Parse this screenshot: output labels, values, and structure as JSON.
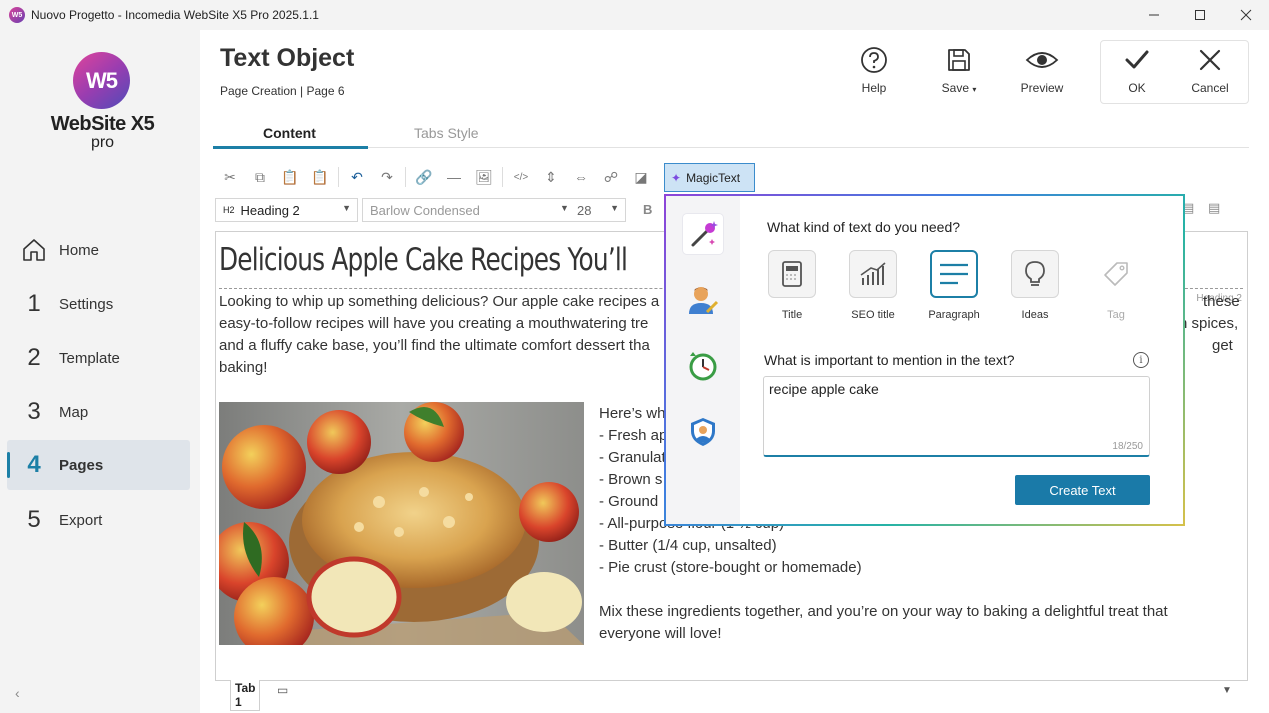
{
  "window": {
    "title": "Nuovo Progetto - Incomedia WebSite X5 Pro 2025.1.1",
    "app_icon_text": "W5"
  },
  "logo": {
    "mark": "W5",
    "name": "WebSite X5",
    "edition": "pro"
  },
  "sidebar": {
    "items": [
      {
        "num": "",
        "label": "Home"
      },
      {
        "num": "1",
        "label": "Settings"
      },
      {
        "num": "2",
        "label": "Template"
      },
      {
        "num": "3",
        "label": "Map"
      },
      {
        "num": "4",
        "label": "Pages"
      },
      {
        "num": "5",
        "label": "Export"
      }
    ],
    "active": "Pages"
  },
  "header": {
    "title": "Text Object",
    "breadcrumb": "Page Creation | Page 6",
    "buttons": {
      "help": "Help",
      "save": "Save",
      "preview": "Preview",
      "ok": "OK",
      "cancel": "Cancel"
    }
  },
  "tabs": {
    "content": "Content",
    "tabs_style": "Tabs Style"
  },
  "toolbar": {
    "magictext": "MagicText"
  },
  "format": {
    "style_tag": "H2",
    "style": "Heading 2",
    "font": "Barlow Condensed",
    "size": "28",
    "bold": "B"
  },
  "editor": {
    "heading": "Delicious Apple Cake Recipes You’ll",
    "heading_tag": "Heading 2",
    "paragraph_lines": [
      "Looking to whip up something delicious? Our apple cake recipes a",
      "easy-to-follow recipes will have you creating a mouthwatering tre",
      "and a fluffy cake base, you’ll find the ultimate comfort dessert tha",
      "baking!"
    ],
    "right_fragments": [
      "these",
      "n spices,",
      "get"
    ],
    "list_lines": [
      "Here’s wh",
      "- Fresh ap",
      "- Granulat",
      "- Brown s",
      "- Ground",
      "- All-purpose flour (1 ½ cup)",
      "- Butter (1/4 cup, unsalted)",
      "- Pie crust (store-bought or homemade)"
    ],
    "closing_lines": [
      "Mix these ingredients together, and you’re on your way to baking a delightful treat that",
      "everyone will love!"
    ]
  },
  "bottom": {
    "tab_label": "Tab 1"
  },
  "magictext_popup": {
    "question1": "What kind of text do you need?",
    "kinds": [
      {
        "label": "Title",
        "icon": "title-doc-icon",
        "state": "normal"
      },
      {
        "label": "SEO title",
        "icon": "seo-chart-icon",
        "state": "normal"
      },
      {
        "label": "Paragraph",
        "icon": "paragraph-lines-icon",
        "state": "selected"
      },
      {
        "label": "Ideas",
        "icon": "lightbulb-icon",
        "state": "normal"
      },
      {
        "label": "Tag",
        "icon": "tag-icon",
        "state": "disabled"
      }
    ],
    "question2": "What is important to mention in the text?",
    "input_value": "recipe apple cake",
    "counter": "18/250",
    "create_button": "Create Text"
  },
  "colors": {
    "accent": "#1c7fa6",
    "create_button": "#1a7aa8",
    "magictext_bg": "#cde3f5"
  }
}
